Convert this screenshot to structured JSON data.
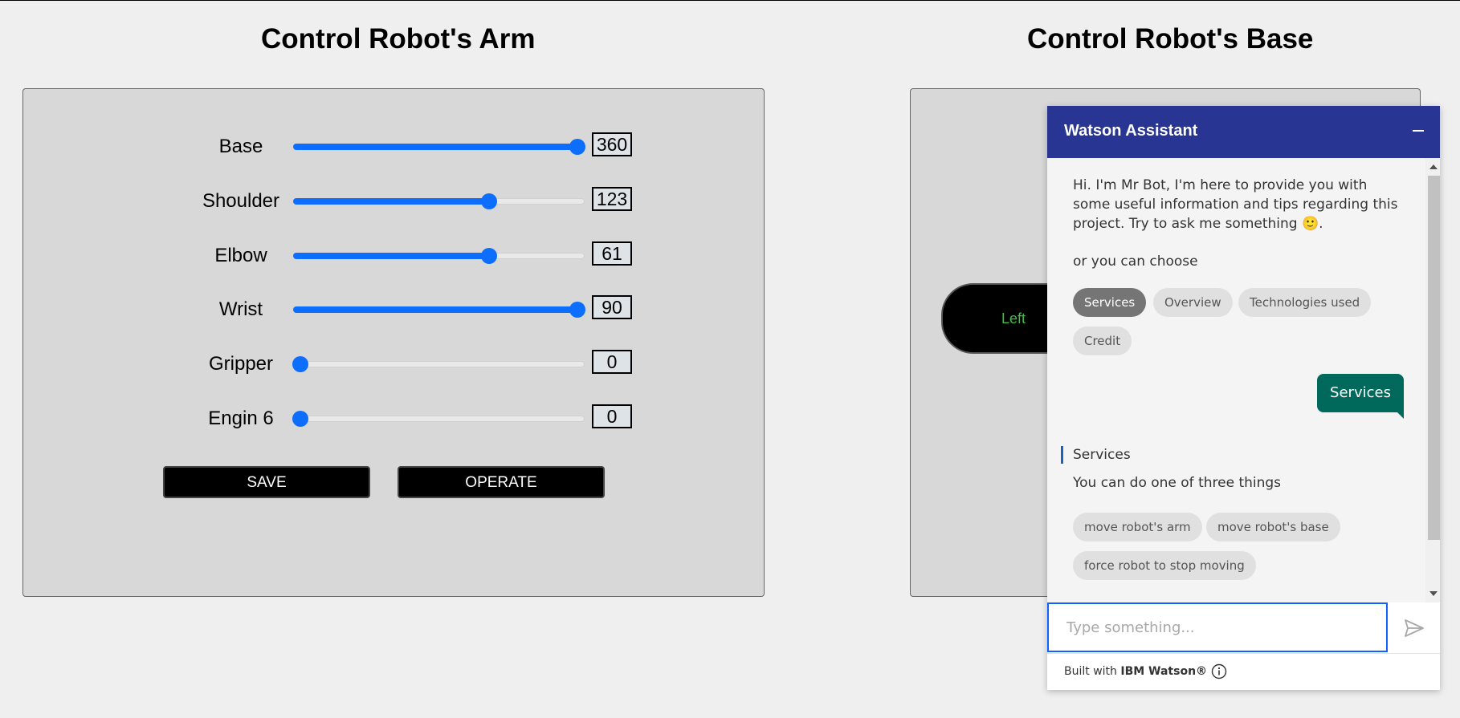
{
  "arm": {
    "title": "Control Robot's Arm",
    "sliders": [
      {
        "label": "Base",
        "value": "360",
        "level": 1.0
      },
      {
        "label": "Shoulder",
        "value": "123",
        "level": 0.68
      },
      {
        "label": "Elbow",
        "value": "61",
        "level": 0.68
      },
      {
        "label": "Wrist",
        "value": "90",
        "level": 1.0
      },
      {
        "label": "Gripper",
        "value": "0",
        "level": 0.0
      },
      {
        "label": "Engin 6",
        "value": "0",
        "level": 0.0
      }
    ],
    "save_label": "SAVE",
    "operate_label": "OPERATE"
  },
  "base": {
    "title": "Control Robot's Base",
    "left_label": "Left"
  },
  "watson": {
    "title": "Watson Assistant",
    "greeting": "Hi. I'm Mr Bot, I'm here to provide you with some useful information and tips regarding this project. Try to ask me something 🙂.",
    "choose_text": "or you can choose",
    "options": [
      "Services",
      "Overview",
      "Technologies used",
      "Credit"
    ],
    "selected_option": "Services",
    "user_message": "Services",
    "reply_title": "Services",
    "reply_text": "You can do one of three things",
    "reply_options": [
      "move robot's arm",
      "move robot's base",
      "force robot to stop moving"
    ],
    "input_placeholder": "Type something...",
    "footer_prefix": "Built with ",
    "footer_brand": "IBM Watson®"
  },
  "colors": {
    "slider": "#0d6efd",
    "watson_header": "#283593",
    "user_bubble": "#00695c",
    "left_text": "#3fbf3f"
  },
  "icons": [
    "minimize-icon",
    "send-icon",
    "info-icon"
  ]
}
